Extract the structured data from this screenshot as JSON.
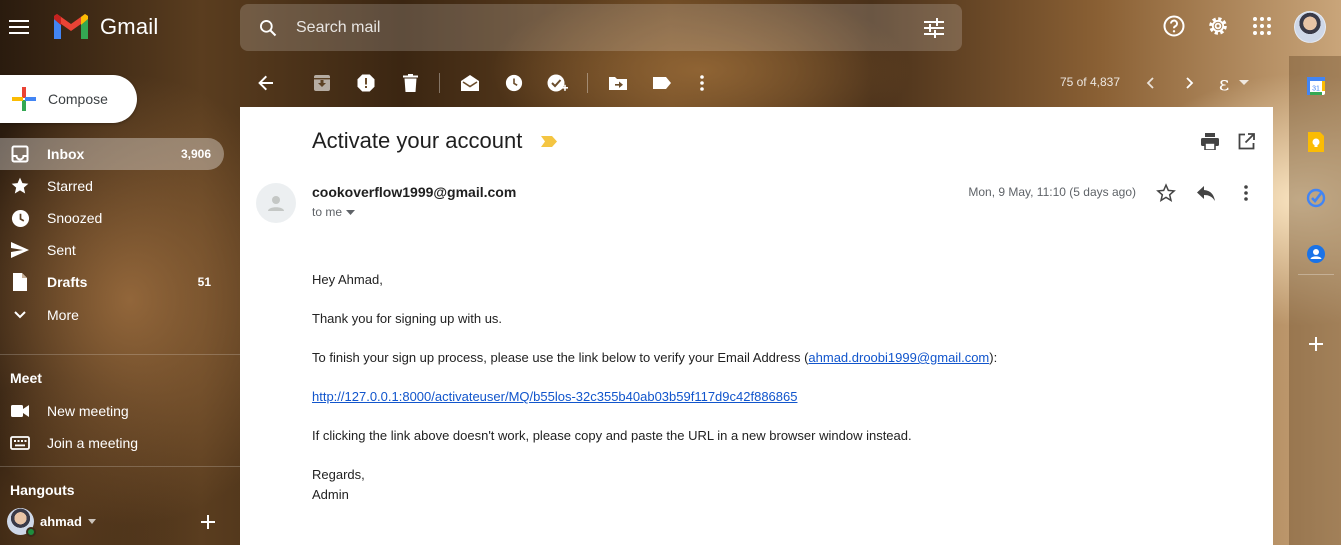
{
  "header": {
    "app_name": "Gmail",
    "search_placeholder": "Search mail"
  },
  "sidebar": {
    "compose_label": "Compose",
    "items": [
      {
        "label": "Inbox",
        "count": "3,906"
      },
      {
        "label": "Starred",
        "count": ""
      },
      {
        "label": "Snoozed",
        "count": ""
      },
      {
        "label": "Sent",
        "count": ""
      },
      {
        "label": "Drafts",
        "count": "51"
      },
      {
        "label": "More",
        "count": ""
      }
    ],
    "meet": {
      "title": "Meet",
      "new_meeting": "New meeting",
      "join_meeting": "Join a meeting"
    },
    "hangouts": {
      "title": "Hangouts",
      "user": "ahmad"
    }
  },
  "toolbar": {
    "pager": "75 of 4,837",
    "input_tool_glyph": "ε"
  },
  "message": {
    "subject": "Activate your account",
    "sender": "cookoverflow1999@gmail.com",
    "to": "to me",
    "date": "Mon, 9 May, 11:10 (5 days ago)",
    "greeting": "Hey Ahmad,",
    "line1": "Thank you for signing up with us.",
    "line2_prefix": "To finish your sign up process, please use the link below to verify your Email Address (",
    "line2_email": "ahmad.droobi1999@gmail.com",
    "line2_suffix": "):",
    "activation_link": "http://127.0.0.1:8000/activateuser/MQ/b55los-32c355b40ab03b59f117d9c42f886865",
    "line3": "If clicking the link above doesn't work, please copy and paste the URL in a new browser window instead.",
    "regards": "Regards,",
    "signature": "Admin"
  },
  "colors": {
    "accent_blue": "#1a73e8",
    "important_marker": "#f4c542",
    "link": "#1155cc"
  }
}
